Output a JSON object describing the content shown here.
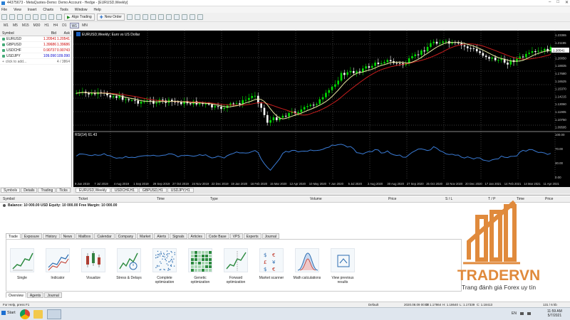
{
  "window": {
    "title": "44375673 - MetaQuotes-Demo: Demo Account - Hedge - [EURUSD,Weekly]",
    "controls": [
      "–",
      "□",
      "✕"
    ]
  },
  "menu": [
    "File",
    "View",
    "Insert",
    "Charts",
    "Tools",
    "Window",
    "Help"
  ],
  "toolbar": {
    "algo_label": "Algo Trading",
    "neworder_label": "New Order"
  },
  "timeframes": [
    "M1",
    "M5",
    "M15",
    "M30",
    "H1",
    "H4",
    "D1",
    "W1",
    "MN"
  ],
  "timeframe_active": "W1",
  "market_watch": {
    "headers": [
      "Symbol",
      "Bid",
      "Ask"
    ],
    "rows": [
      {
        "symbol": "EURUSD",
        "bid": "1.20541",
        "ask": "1.20541"
      },
      {
        "symbol": "GBPUSD",
        "bid": "1.39686",
        "ask": "1.39686"
      },
      {
        "symbol": "USDCHF",
        "bid": "0.90737",
        "ask": "0.90743"
      },
      {
        "symbol": "USDJPY",
        "bid": "109.090",
        "ask": "109.090"
      }
    ],
    "add_label": "click to add...",
    "add_count": "4 / 3864",
    "tabs": [
      "Symbols",
      "Details",
      "Trading",
      "Ticks"
    ]
  },
  "chart": {
    "title": "EURUSD,Weekly: Euro vs US Dollar",
    "price_labels": [
      "1.23365",
      "1.21195",
      "1.20541",
      "1.20050",
      "1.18835",
      "1.17680",
      "1.16525",
      "1.15370",
      "1.14215",
      "1.13060",
      "1.11905",
      "1.10750",
      "1.09595"
    ],
    "current_price": "1.20541",
    "rsi_label": "RSI(14) 61.43",
    "rsi_levels": [
      "100.00",
      "70.00",
      "30.00",
      "0.00"
    ],
    "date_labels": [
      "9 Jun 2019",
      "7 Jul 2019",
      "4 Aug 2019",
      "1 Sep 2019",
      "29 Sep 2019",
      "27 Oct 2019",
      "24 Nov 2019",
      "22 Dec 2019",
      "19 Jan 2020",
      "16 Feb 2020",
      "15 Mar 2020",
      "12 Apr 2020",
      "10 May 2020",
      "7 Jun 2020",
      "5 Jul 2020",
      "2 Aug 2020",
      "30 Aug 2020",
      "27 Sep 2020",
      "25 Oct 2020",
      "22 Nov 2020",
      "20 Dec 2020",
      "17 Jan 2021",
      "14 Feb 2021",
      "14 Mar 2021",
      "11 Apr 2021"
    ],
    "colors": {
      "up": "#00dd00",
      "down": "#ffffff",
      "ma_fast": "#e8e8a0",
      "ma_slow": "#c81e1e",
      "rsi": "#3a7bd5",
      "grid": "#3a3a3a"
    }
  },
  "chart_tabs": [
    "EURUSD,Weekly",
    "USDCHF,H1",
    "GBPUSD,H1",
    "USDJPY,H1"
  ],
  "chart_tab_active": "EURUSD,Weekly",
  "trade_headers": [
    "Symbol",
    "Ticket",
    "Time",
    "Type",
    "Volume",
    "Price",
    "S / L",
    "T / P",
    "Time",
    "Price"
  ],
  "balance_line": "Balance: 10 000.00 USD  Equity: 10 000.00  Free Margin: 10 000.00",
  "toolbox_tabs": [
    "Trade",
    "Exposure",
    "History",
    "News",
    "Mailbox",
    "Calendar",
    "Company",
    "Market",
    "Alerts",
    "Signals",
    "Articles",
    "Code Base",
    "VPS",
    "Experts",
    "Journal"
  ],
  "toolbox_active": "Trade",
  "tiles": [
    {
      "label": "Single",
      "icon": "single-test-icon"
    },
    {
      "label": "Indicator",
      "icon": "indicator-icon"
    },
    {
      "label": "Visualize",
      "icon": "visualize-icon"
    },
    {
      "label": "Stress & Delays",
      "icon": "stress-icon"
    },
    {
      "label": "Complete optimization",
      "icon": "complete-optimization-icon"
    },
    {
      "label": "Genetic optimization",
      "icon": "genetic-optimization-icon"
    },
    {
      "label": "Forward optimization",
      "icon": "forward-optimization-icon"
    },
    {
      "label": "Market scanner",
      "icon": "market-scanner-icon"
    },
    {
      "label": "Math calculations",
      "icon": "math-icon"
    },
    {
      "label": "View previous results",
      "icon": "previous-results-icon"
    }
  ],
  "bottom_tabs": [
    "Overview",
    "Agents",
    "Journal"
  ],
  "status": {
    "help": "For Help, press F1",
    "profile": "Default",
    "datetime": "2020.08.09 00:00",
    "open": "O: 1.17864",
    "high": "H: 1.18640",
    "low": "L: 1.17339",
    "close": "C: 1.18413",
    "traffic": "131 / 6 kb"
  },
  "taskbar": {
    "start_label": "Start",
    "lang": "EN",
    "time": "11:59 AM",
    "date": "5/7/2021"
  },
  "logo": {
    "brand": "TRADERVN",
    "tagline": "Trang đánh giá Forex uy tín",
    "color": "#e08a3c"
  }
}
